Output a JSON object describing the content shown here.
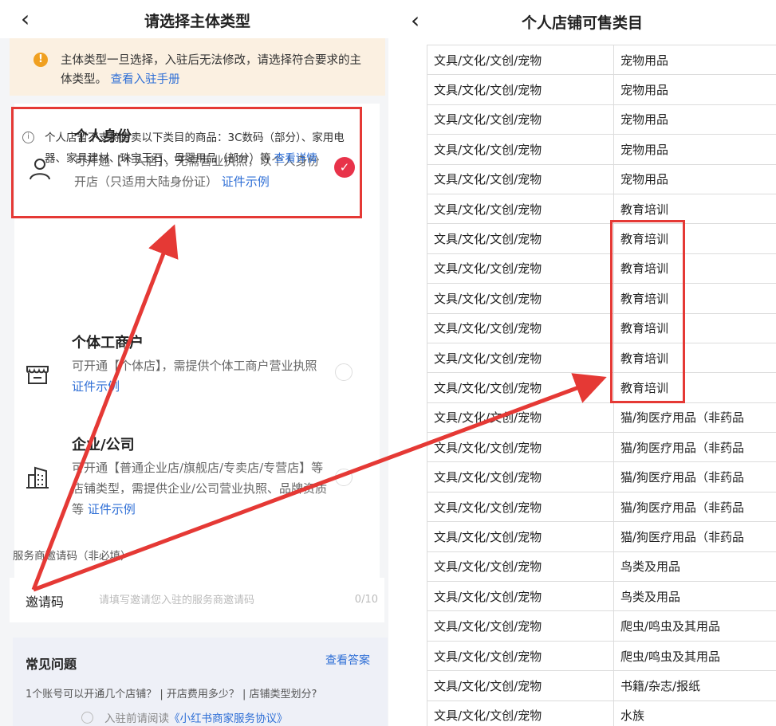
{
  "left": {
    "title": "请选择主体类型",
    "notice": {
      "text": "主体类型一旦选择，入驻后无法修改，请选择符合要求的主体类型。",
      "link": "查看入驻手册"
    },
    "options": [
      {
        "name": "个人身份",
        "desc": "可开通【个人店】，无需营业执照，以个人身份开店（只适用大陆身份证）",
        "link": "证件示例",
        "selected": true
      },
      {
        "name": "个体工商户",
        "desc": "可开通【个体店】，需提供个体工商户营业执照",
        "link": "证件示例",
        "selected": false
      },
      {
        "name": "企业/公司",
        "desc": "可开通【普通企业店/旗舰店/专卖店/专营店】等店铺类型，需提供企业/公司营业执照、品牌资质等",
        "link": "证件示例",
        "selected": false
      }
    ],
    "info": {
      "text": "个人店暂不支持售卖以下类目的商品：3C数码（部分）、家用电器、家具建材、珠宝玉石、母婴用品（部分）等",
      "link": "查看详情"
    },
    "invite": {
      "section_label": "服务商邀请码（非必填）",
      "label": "邀请码",
      "placeholder": "请填写邀请您入驻的服务商邀请码",
      "count": "0/10"
    },
    "faq": {
      "title": "常见问题",
      "answer_link": "查看答案",
      "questions": "1个账号可以开通几个店铺？ | 开店费用多少？ | 店铺类型划分?"
    },
    "agreement": {
      "prefix": "入驻前请阅读",
      "link": "《小红书商家服务协议》"
    }
  },
  "right": {
    "title": "个人店铺可售类目",
    "rows": [
      [
        "文具/文化/文创/宠物",
        "宠物用品"
      ],
      [
        "文具/文化/文创/宠物",
        "宠物用品"
      ],
      [
        "文具/文化/文创/宠物",
        "宠物用品"
      ],
      [
        "文具/文化/文创/宠物",
        "宠物用品"
      ],
      [
        "文具/文化/文创/宠物",
        "宠物用品"
      ],
      [
        "文具/文化/文创/宠物",
        "教育培训"
      ],
      [
        "文具/文化/文创/宠物",
        "教育培训"
      ],
      [
        "文具/文化/文创/宠物",
        "教育培训"
      ],
      [
        "文具/文化/文创/宠物",
        "教育培训"
      ],
      [
        "文具/文化/文创/宠物",
        "教育培训"
      ],
      [
        "文具/文化/文创/宠物",
        "教育培训"
      ],
      [
        "文具/文化/文创/宠物",
        "教育培训"
      ],
      [
        "文具/文化/文创/宠物",
        "猫/狗医疗用品（非药品"
      ],
      [
        "文具/文化/文创/宠物",
        "猫/狗医疗用品（非药品"
      ],
      [
        "文具/文化/文创/宠物",
        "猫/狗医疗用品（非药品"
      ],
      [
        "文具/文化/文创/宠物",
        "猫/狗医疗用品（非药品"
      ],
      [
        "文具/文化/文创/宠物",
        "猫/狗医疗用品（非药品"
      ],
      [
        "文具/文化/文创/宠物",
        "鸟类及用品"
      ],
      [
        "文具/文化/文创/宠物",
        "鸟类及用品"
      ],
      [
        "文具/文化/文创/宠物",
        "爬虫/鸣虫及其用品"
      ],
      [
        "文具/文化/文创/宠物",
        "爬虫/鸣虫及其用品"
      ],
      [
        "文具/文化/文创/宠物",
        "书籍/杂志/报纸"
      ],
      [
        "文具/文化/文创/宠物",
        "水族"
      ]
    ]
  },
  "colors": {
    "accent_red": "#e8334a",
    "annotation_red": "#e53935",
    "link_blue": "#2f6fd6",
    "notice_bg": "#fbf0e1"
  }
}
